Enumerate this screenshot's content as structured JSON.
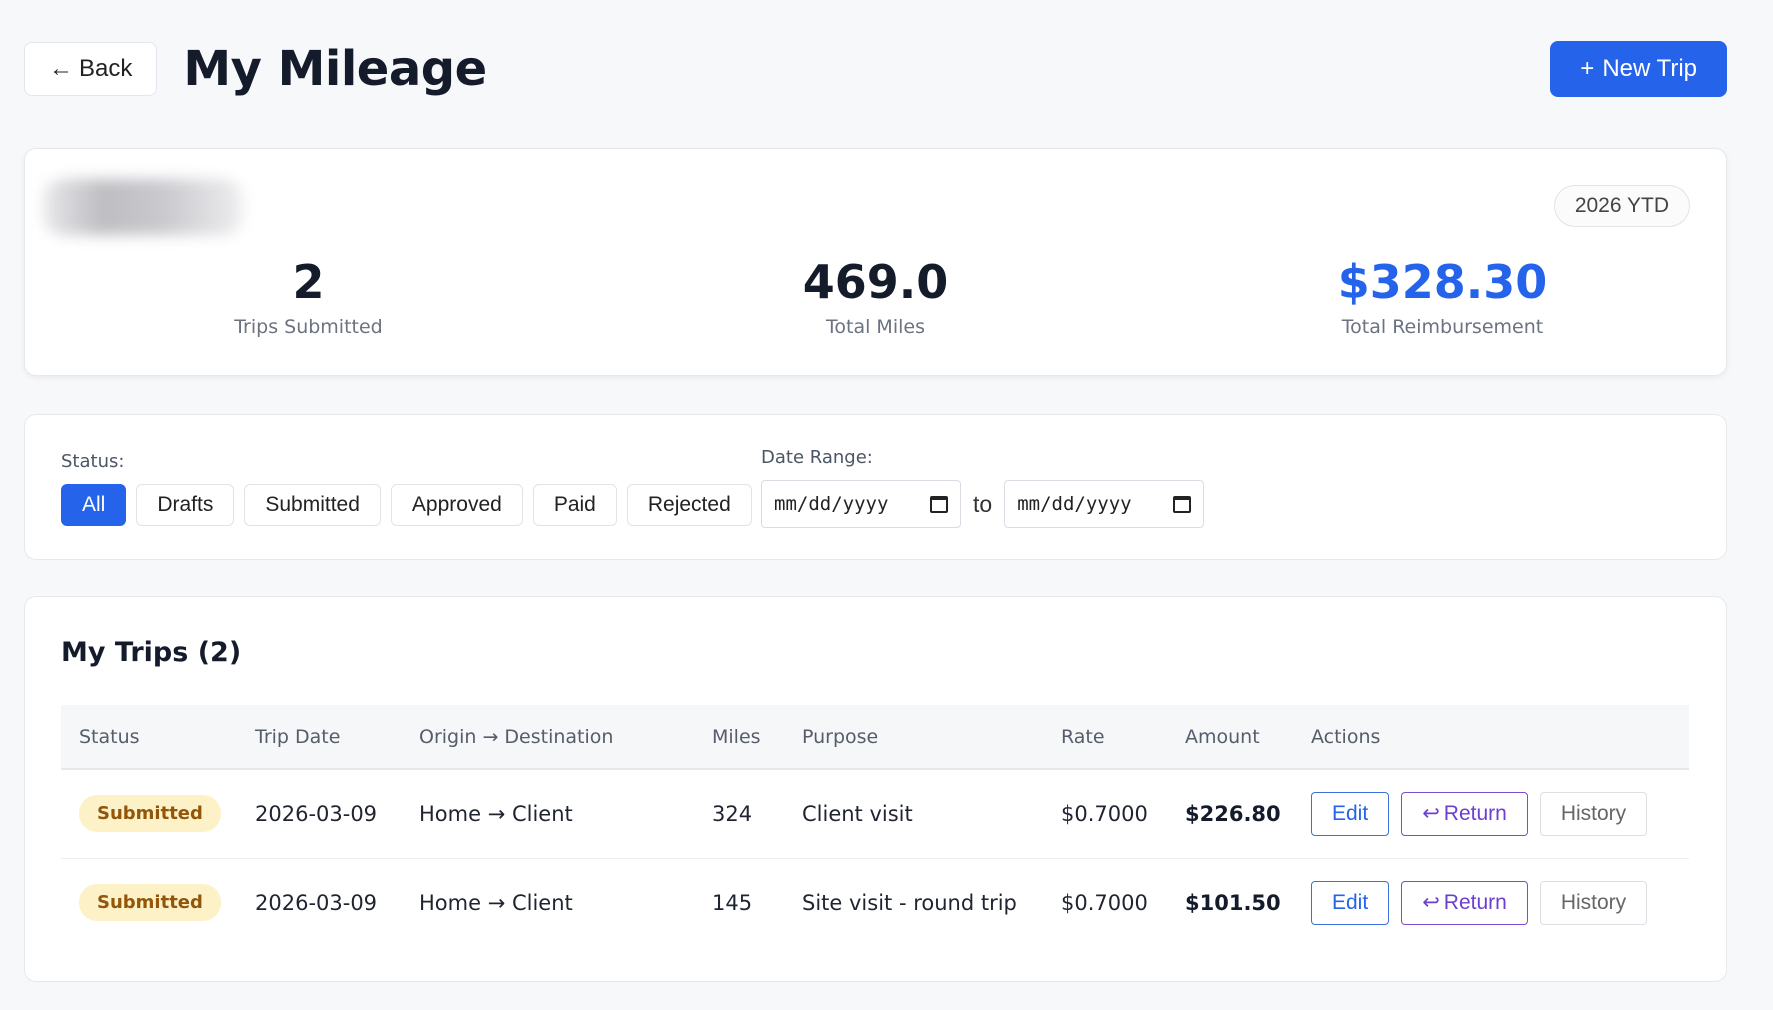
{
  "header": {
    "back_label": "Back",
    "title": "My Mileage",
    "new_trip_label": "New Trip"
  },
  "summary": {
    "period_badge": "2026 YTD",
    "stats": [
      {
        "value": "2",
        "label": "Trips Submitted"
      },
      {
        "value": "469.0",
        "label": "Total Miles"
      },
      {
        "value": "$328.30",
        "label": "Total Reimbursement"
      }
    ]
  },
  "filters": {
    "status_label": "Status:",
    "status_options": [
      "All",
      "Drafts",
      "Submitted",
      "Approved",
      "Paid",
      "Rejected"
    ],
    "selected_status": "All",
    "date_range_label": "Date Range:",
    "date_from_placeholder": "mm/dd/yyyy",
    "date_to_placeholder": "mm/dd/yyyy",
    "date_separator": "to"
  },
  "trips": {
    "title": "My Trips (2)",
    "columns": [
      "Status",
      "Trip Date",
      "Origin → Destination",
      "Miles",
      "Purpose",
      "Rate",
      "Amount",
      "Actions"
    ],
    "rows": [
      {
        "status": "Submitted",
        "date": "2026-03-09",
        "route": "Home → Client",
        "miles": "324",
        "purpose": "Client visit",
        "rate": "$0.7000",
        "amount": "$226.80"
      },
      {
        "status": "Submitted",
        "date": "2026-03-09",
        "route": "Home → Client",
        "miles": "145",
        "purpose": "Site visit - round trip",
        "rate": "$0.7000",
        "amount": "$101.50"
      }
    ],
    "actions": {
      "edit": "Edit",
      "return": "Return",
      "history": "History"
    }
  },
  "colors": {
    "primary": "#2563eb",
    "status_badge_bg": "#fdf1c8",
    "status_badge_text": "#92560a",
    "return_purple": "#6d3fd0"
  },
  "icons": {
    "back": "arrow-left-icon",
    "new_trip": "plus-icon",
    "date": "calendar-icon",
    "return": "return-arrow-icon"
  }
}
